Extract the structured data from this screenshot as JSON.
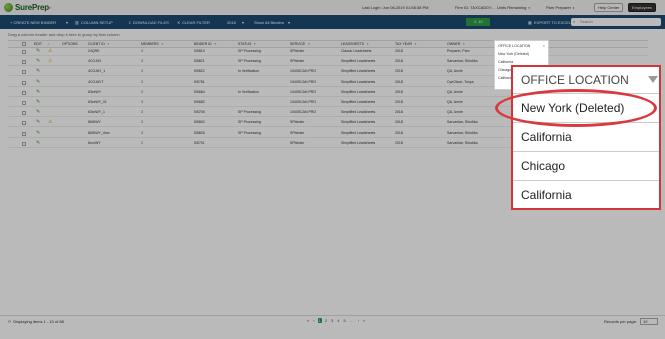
{
  "brand": {
    "name": "SurePrep"
  },
  "header": {
    "last_login": "Last Login: Jun 06,2019 01:58:38 PM",
    "firm_id": "Firm ID: TAXCADDY...",
    "units": "Units Remaining",
    "role": "Pam Preparer",
    "help_center": "Help Center",
    "user": "Employees"
  },
  "toolbar": {
    "create": "+ CREATE NEW BINDER",
    "column_setup": "COLUMN SETUP",
    "download": "DOWNLOAD FILES",
    "clear_filter": "CLEAR FILTER",
    "year": "2018",
    "show": "Show All Binders",
    "warn_count": "10",
    "export": "EXPORT TO EXCEL",
    "search_placeholder": "Search"
  },
  "group_hint": "Drag a column header and drop it here to group by that column",
  "columns": [
    "EDIT",
    "OPTIONS",
    "CLIENT ID",
    "MEMBERS",
    "BINDER ID",
    "STATUS",
    "SERVICE",
    "LEADSHEETS",
    "TAX YEAR",
    "OWNER"
  ],
  "rows": [
    {
      "client": "24QRK",
      "members": "3",
      "binder": "5/5810",
      "status": "SP Processing",
      "service": "SPbinder",
      "lead": "Classic Leadsheets",
      "year": "2018",
      "owner": "Preparer, Pam",
      "warn": true
    },
    {
      "client": "4CGJAY",
      "members": "3",
      "binder": "5/5821",
      "status": "SP Processing",
      "service": "SPbinder",
      "lead": "Simplified Leadsheets",
      "year": "2018",
      "owner": "Sarvankar, Shrutika",
      "warn": true
    },
    {
      "client": "4CGJAY_1",
      "members": "3",
      "binder": "5/5822",
      "status": "In Verification",
      "service": "1040SCAN PRO",
      "lead": "Simplified Leadsheets",
      "year": "2018",
      "owner": "QA, Annie",
      "warn": false
    },
    {
      "client": "4CGJAYT",
      "members": "3",
      "binder": "5/5781",
      "status": "",
      "service": "1040SCAN PRO",
      "lead": "Simplified Leadsheets",
      "year": "2018",
      "owner": "CyeOlson, Tonya",
      "warn": false
    },
    {
      "client": "63xxWY",
      "members": "2",
      "binder": "5/5684",
      "status": "In Verification",
      "service": "1040SCAN PRO",
      "lead": "Simplified Leadsheets",
      "year": "2018",
      "owner": "QA, Annie",
      "warn": false
    },
    {
      "client": "63xxWY_01",
      "members": "3",
      "binder": "5/5682",
      "status": "",
      "service": "1040SCAN PRO",
      "lead": "Simplified Leadsheets",
      "year": "2018",
      "owner": "QA, Annie",
      "warn": false
    },
    {
      "client": "63xxWY_1",
      "members": "3",
      "binder": "5/5706",
      "status": "SP Processing",
      "service": "1040SCAN PRO",
      "lead": "Simplified Leadsheets",
      "year": "2018",
      "owner": "QA, Annie",
      "warn": false
    },
    {
      "client": "86WWY",
      "members": "3",
      "binder": "5/5802",
      "status": "SP Processing",
      "service": "SPbinder",
      "lead": "Simplified Leadsheets",
      "year": "2018",
      "owner": "Sarvankar, Shrutika",
      "warn": true
    },
    {
      "client": "86WWY_dmo",
      "members": "3",
      "binder": "5/5826",
      "status": "SP Processing",
      "service": "SPbinder",
      "lead": "Simplified Leadsheets",
      "year": "2018",
      "owner": "Sarvankar, Shrutika",
      "warn": false
    },
    {
      "client": "8ronWY",
      "members": "2",
      "binder": "5/5701",
      "status": "",
      "service": "SPbinder",
      "lead": "Simplified Leadsheets",
      "year": "2018",
      "owner": "Sarvankar, Shrutika",
      "warn": false
    }
  ],
  "footer": {
    "displaying": "Displaying items 1 - 10 of 88",
    "pages": [
      "1",
      "2",
      "3",
      "4",
      "5"
    ],
    "per_page_label": "Records per page:",
    "per_page": "10"
  },
  "office_popup_small": {
    "header": "OFFICE LOCATION",
    "items": [
      "New York (Deleted)",
      "California",
      "Chicago",
      "California"
    ]
  },
  "office_popup_zoom": {
    "header": "OFFICE LOCATION",
    "items": [
      "New York (Deleted)",
      "California",
      "Chicago",
      "California"
    ]
  }
}
